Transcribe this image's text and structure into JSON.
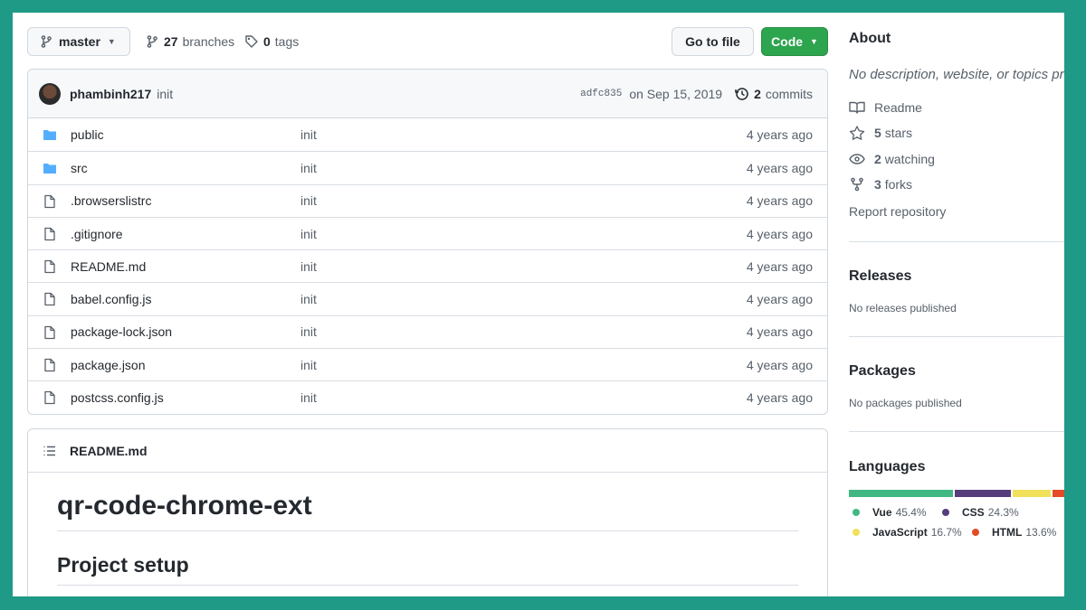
{
  "topbar": {
    "branch": "master",
    "branches_count": "27",
    "branches_label": "branches",
    "tags_count": "0",
    "tags_label": "tags",
    "go_to_file": "Go to file",
    "code": "Code"
  },
  "commit": {
    "author": "phambinh217",
    "message": "init",
    "sha": "adfc835",
    "date": "on Sep 15, 2019",
    "commits_count": "2",
    "commits_label": "commits"
  },
  "files": [
    {
      "name": "public",
      "type": "dir",
      "message": "init",
      "age": "4 years ago"
    },
    {
      "name": "src",
      "type": "dir",
      "message": "init",
      "age": "4 years ago"
    },
    {
      "name": ".browserslistrc",
      "type": "file",
      "message": "init",
      "age": "4 years ago"
    },
    {
      "name": ".gitignore",
      "type": "file",
      "message": "init",
      "age": "4 years ago"
    },
    {
      "name": "README.md",
      "type": "file",
      "message": "init",
      "age": "4 years ago"
    },
    {
      "name": "babel.config.js",
      "type": "file",
      "message": "init",
      "age": "4 years ago"
    },
    {
      "name": "package-lock.json",
      "type": "file",
      "message": "init",
      "age": "4 years ago"
    },
    {
      "name": "package.json",
      "type": "file",
      "message": "init",
      "age": "4 years ago"
    },
    {
      "name": "postcss.config.js",
      "type": "file",
      "message": "init",
      "age": "4 years ago"
    }
  ],
  "readme": {
    "filename": "README.md",
    "title": "qr-code-chrome-ext",
    "h2": "Project setup"
  },
  "about": {
    "title": "About",
    "description": "No description, website, or topics provided.",
    "readme": "Readme",
    "stars_count": "5",
    "stars_label": "stars",
    "watching_count": "2",
    "watching_label": "watching",
    "forks_count": "3",
    "forks_label": "forks",
    "report": "Report repository"
  },
  "releases": {
    "title": "Releases",
    "empty": "No releases published"
  },
  "packages": {
    "title": "Packages",
    "empty": "No packages published"
  },
  "languages": {
    "title": "Languages",
    "items": [
      {
        "name": "Vue",
        "percent": "45.4%",
        "value": 45.4,
        "color": "#41b883"
      },
      {
        "name": "CSS",
        "percent": "24.3%",
        "value": 24.3,
        "color": "#563d7c"
      },
      {
        "name": "JavaScript",
        "percent": "16.7%",
        "value": 16.7,
        "color": "#f1e05a"
      },
      {
        "name": "HTML",
        "percent": "13.6%",
        "value": 13.6,
        "color": "#e34c26"
      }
    ]
  }
}
